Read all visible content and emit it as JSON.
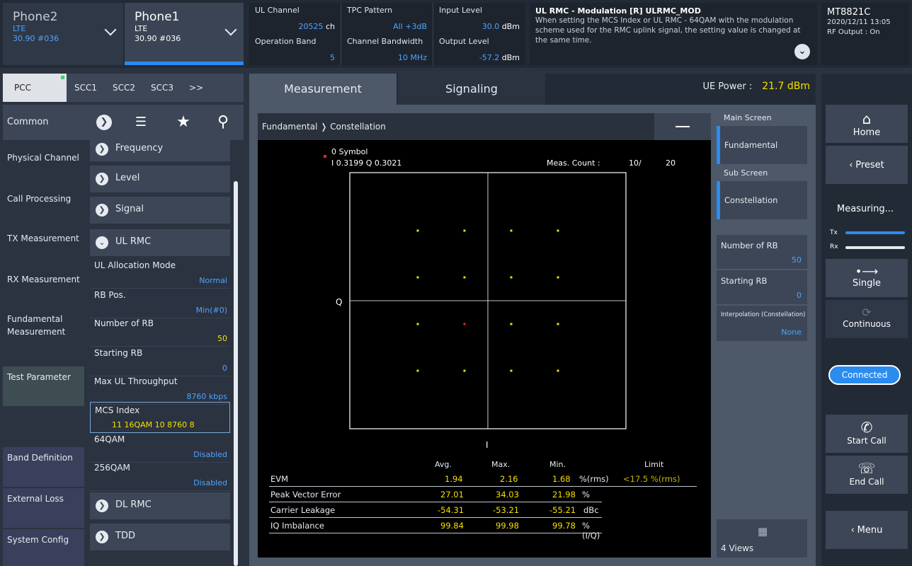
{
  "phones": [
    {
      "name": "Phone2",
      "type": "LTE",
      "value": "30.90 #036"
    },
    {
      "name": "Phone1",
      "type": "LTE",
      "value": "30.90 #036"
    }
  ],
  "params": {
    "ul_channel": {
      "label": "UL Channel",
      "value": "20525",
      "unit": "ch"
    },
    "tpc_pattern": {
      "label": "TPC Pattern",
      "value": "All +3dB"
    },
    "input_level": {
      "label": "Input Level",
      "value": "30.0",
      "unit": "dBm"
    },
    "operation_band": {
      "label": "Operation Band",
      "value": "5"
    },
    "channel_bandwidth": {
      "label": "Channel Bandwidth",
      "value": "10 MHz"
    },
    "output_level": {
      "label": "Output Level",
      "value": "-57.2",
      "unit": "dBm"
    }
  },
  "help": {
    "title": "UL RMC - Modulation [R] ULRMC_MOD",
    "text": "When setting the MCS Index or UL RMC - 64QAM with the modulation scheme used for the RMC uplink signal, the setting value is changed at the same time."
  },
  "brand": {
    "name": "MT8821C",
    "date": "2020/12/11 13:05",
    "rf": "RF Output : On"
  },
  "carriers": [
    "PCC",
    "SCC1",
    "SCC2",
    "SCC3",
    ">>"
  ],
  "categories": {
    "common": "Common",
    "items": [
      "Physical Channel",
      "Call Processing",
      "TX Measurement",
      "RX Measurement",
      "Fundamental Measurement",
      "Test Parameter",
      "Band Definition",
      "External Loss",
      "System Config"
    ]
  },
  "list": {
    "frequency": "Frequency",
    "level": "Level",
    "signal": "Signal",
    "ul_rmc": "UL RMC",
    "ul_alloc": {
      "label": "UL Allocation Mode",
      "value": "Normal"
    },
    "rb_pos": {
      "label": "RB Pos.",
      "value": "Min(#0)"
    },
    "num_rb": {
      "label": "Number of RB",
      "value": "50"
    },
    "starting_rb": {
      "label": "Starting RB",
      "value": "0"
    },
    "max_ul": {
      "label": "Max UL Throughput",
      "value": "8760 kbps"
    },
    "mcs": {
      "label": "MCS Index",
      "value": "11   16QAM  10  8760  8"
    },
    "qam64": {
      "label": "64QAM",
      "value": "Disabled"
    },
    "qam256": {
      "label": "256QAM",
      "value": "Disabled"
    },
    "dl_rmc": "DL RMC",
    "tdd": "TDD"
  },
  "tabs": {
    "measurement": "Measurement",
    "signaling": "Signaling"
  },
  "ue_power": {
    "label": "UE Power :",
    "value": "21.7 dBm"
  },
  "scope": {
    "breadcrumb": "Fundamental  ❭  Constellation",
    "symbol": "0 Symbol",
    "iq": "I  0.3199 Q  0.3021",
    "meas_count_label": "Meas. Count :",
    "meas_count": "10/",
    "meas_total": "20",
    "q_axis": "Q",
    "i_axis": "I"
  },
  "results": {
    "headers": [
      "Avg.",
      "Max.",
      "Min.",
      "Limit"
    ],
    "rows": [
      {
        "label": "EVM",
        "avg": "1.94",
        "max": "2.16",
        "min": "1.68",
        "unit": "%(rms)",
        "limit": "<17.5 %(rms)"
      },
      {
        "label": "Peak Vector Error",
        "avg": "27.01",
        "max": "34.03",
        "min": "21.98",
        "unit": "%"
      },
      {
        "label": "Carrier Leakage",
        "avg": "-54.31",
        "max": "-53.21",
        "min": "-55.21",
        "unit": "dBc"
      },
      {
        "label": "IQ Imbalance",
        "avg": "99.84",
        "max": "99.98",
        "min": "99.78",
        "unit": "%(I/Q)"
      }
    ]
  },
  "right_panel": {
    "main_screen": "Main Screen",
    "fundamental": "Fundamental",
    "sub_screen": "Sub Screen",
    "constellation": "Constellation",
    "num_rb": {
      "label": "Number of RB",
      "value": "50"
    },
    "starting_rb": {
      "label": "Starting RB",
      "value": "0"
    },
    "interpolation": {
      "label": "Interpolation (Constellation)",
      "value": "None"
    },
    "views": "4 Views"
  },
  "sidebar": {
    "home": "Home",
    "preset": "Preset",
    "measuring": "Measuring...",
    "tx": "Tx",
    "rx": "Rx",
    "single": "Single",
    "continuous": "Continuous",
    "connected": "Connected",
    "start_call": "Start Call",
    "end_call": "End Call",
    "menu": "Menu"
  },
  "colors": {
    "accent": "#2b8cf0",
    "value_yellow": "#f5e000",
    "marker_red": "#ff2020"
  }
}
